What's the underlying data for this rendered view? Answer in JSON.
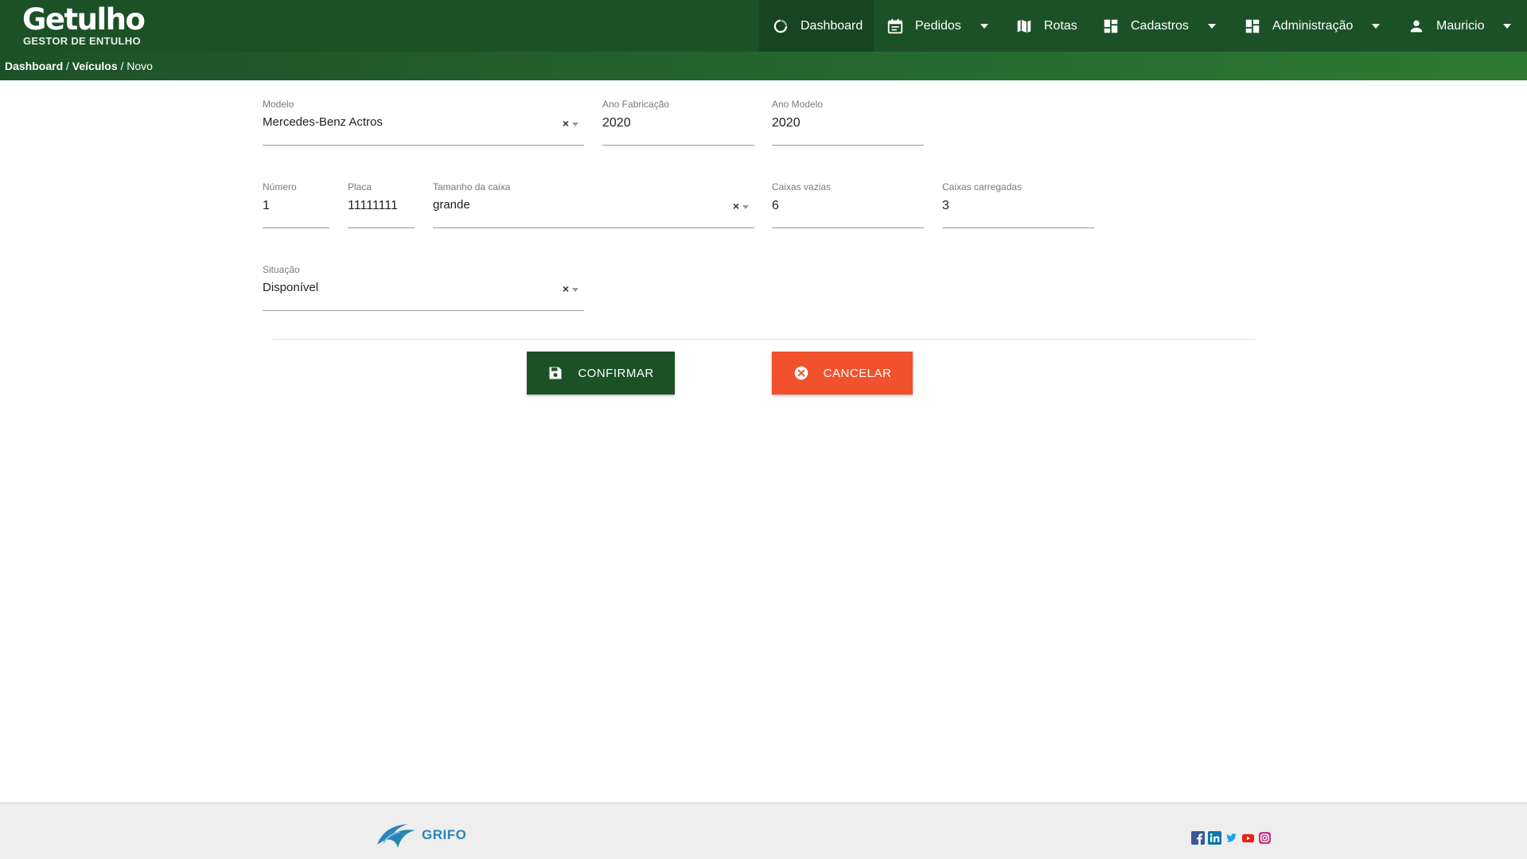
{
  "app": {
    "logo_title": "Getulho",
    "logo_subtitle": "GESTOR DE ENTULHO"
  },
  "nav": {
    "dashboard": "Dashboard",
    "pedidos": "Pedidos",
    "rotas": "Rotas",
    "cadastros": "Cadastros",
    "administracao": "Administração",
    "user": "Mauricio"
  },
  "breadcrumb": {
    "dashboard": "Dashboard",
    "sep1": " / ",
    "veiculos": "Veículos",
    "sep2": " / ",
    "current": "Novo"
  },
  "form": {
    "modelo": {
      "label": "Modelo",
      "value": "Mercedes-Benz Actros"
    },
    "ano_fabricacao": {
      "label": "Ano Fabricação",
      "value": "2020"
    },
    "ano_modelo": {
      "label": "Ano Modelo",
      "value": "2020"
    },
    "numero": {
      "label": "Número",
      "value": "1"
    },
    "placa": {
      "label": "Placa",
      "value": "11111111"
    },
    "tamanho_caixa": {
      "label": "Tamanho da caixa",
      "value": "grande"
    },
    "caixas_vazias": {
      "label": "Caixas vazias",
      "value": "6"
    },
    "caixas_carregadas": {
      "label": "Caixas carregadas",
      "value": "3"
    },
    "situacao": {
      "label": "Situação",
      "value": "Disponível"
    },
    "clear_symbol": "×"
  },
  "buttons": {
    "confirm": "CONFIRMAR",
    "cancel": "CANCELAR"
  },
  "footer": {
    "brand": "GRIFO",
    "social_icons": [
      "facebook-icon",
      "linkedin-icon",
      "twitter-icon",
      "youtube-icon",
      "instagram-icon"
    ]
  },
  "colors": {
    "primary_green": "#1c5128",
    "cancel_orange": "#f1512c",
    "grifo_blue": "#2a86b6"
  }
}
